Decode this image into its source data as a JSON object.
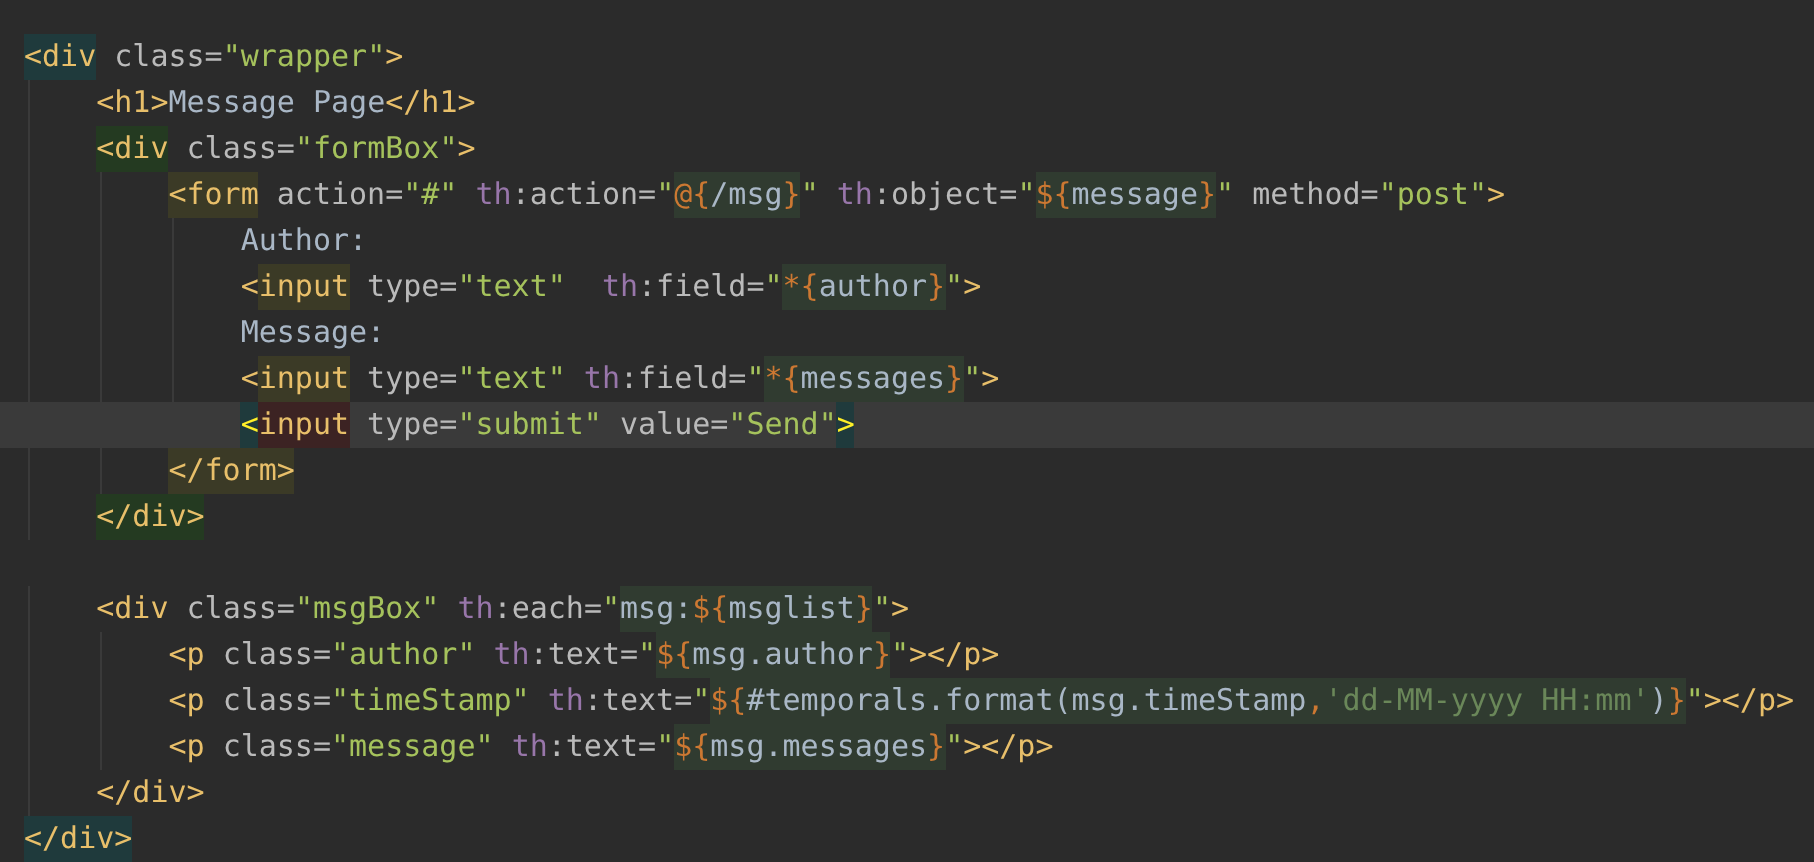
{
  "editor": {
    "lines": [
      {
        "current": false,
        "tokens": [
          {
            "kind": "tag",
            "text": "<div",
            "color": "#1f3a3c"
          },
          {
            "kind": "attr",
            "text": " class="
          },
          {
            "kind": "str",
            "text": "\"wrapper\""
          },
          {
            "kind": "tag",
            "text": ">"
          }
        ]
      },
      {
        "current": false,
        "tokens": [
          {
            "kind": "tag",
            "text": "    <h1>"
          },
          {
            "kind": "text",
            "text": "Message Page"
          },
          {
            "kind": "tag",
            "text": "</h1>"
          }
        ]
      },
      {
        "current": false,
        "tokens": [
          {
            "kind": "tag",
            "text": "    <div",
            "color": "#243a21"
          },
          {
            "kind": "attr",
            "text": " class="
          },
          {
            "kind": "str",
            "text": "\"formBox\""
          },
          {
            "kind": "tag",
            "text": ">"
          }
        ]
      },
      {
        "current": false,
        "tokens": [
          {
            "kind": "tag",
            "text": "        <form",
            "color": "#3b3a26"
          },
          {
            "kind": "attr",
            "text": " action="
          },
          {
            "kind": "str",
            "text": "\"#\""
          },
          {
            "kind": "ns",
            "text": " th"
          },
          {
            "kind": "attr",
            "text": ":action="
          },
          {
            "kind": "str",
            "text": "\""
          },
          {
            "kind": "brace",
            "text": "@{",
            "color": "#303b30"
          },
          {
            "kind": "ident",
            "text": "/msg",
            "color": "#303b30"
          },
          {
            "kind": "brace",
            "text": "}",
            "color": "#303b30"
          },
          {
            "kind": "str",
            "text": "\""
          },
          {
            "kind": "ns",
            "text": " th"
          },
          {
            "kind": "attr",
            "text": ":object="
          },
          {
            "kind": "str",
            "text": "\""
          },
          {
            "kind": "brace",
            "text": "${",
            "color": "#303b30"
          },
          {
            "kind": "ident",
            "text": "message",
            "color": "#303b30"
          },
          {
            "kind": "brace",
            "text": "}",
            "color": "#303b30"
          },
          {
            "kind": "str",
            "text": "\""
          },
          {
            "kind": "attr",
            "text": " method="
          },
          {
            "kind": "str",
            "text": "\"post\""
          },
          {
            "kind": "tag",
            "text": ">"
          }
        ]
      },
      {
        "current": false,
        "tokens": [
          {
            "kind": "text",
            "text": "            Author:"
          }
        ]
      },
      {
        "current": false,
        "tokens": [
          {
            "kind": "tag",
            "text": "            <"
          },
          {
            "kind": "tag",
            "text": "input",
            "color": "#3b3a26"
          },
          {
            "kind": "attr",
            "text": " type="
          },
          {
            "kind": "str",
            "text": "\"text\""
          },
          {
            "kind": "ns",
            "text": "  th"
          },
          {
            "kind": "attr",
            "text": ":field="
          },
          {
            "kind": "str",
            "text": "\""
          },
          {
            "kind": "brace",
            "text": "*{",
            "color": "#303b30"
          },
          {
            "kind": "ident",
            "text": "author",
            "color": "#303b30"
          },
          {
            "kind": "brace",
            "text": "}",
            "color": "#303b30"
          },
          {
            "kind": "str",
            "text": "\""
          },
          {
            "kind": "tag",
            "text": ">"
          }
        ]
      },
      {
        "current": false,
        "tokens": [
          {
            "kind": "text",
            "text": "            Message:"
          }
        ]
      },
      {
        "current": false,
        "tokens": [
          {
            "kind": "tag",
            "text": "            <"
          },
          {
            "kind": "tag",
            "text": "input",
            "color": "#3b3a26"
          },
          {
            "kind": "attr",
            "text": " type="
          },
          {
            "kind": "str",
            "text": "\"text\""
          },
          {
            "kind": "ns",
            "text": " th"
          },
          {
            "kind": "attr",
            "text": ":field="
          },
          {
            "kind": "str",
            "text": "\""
          },
          {
            "kind": "brace",
            "text": "*{",
            "color": "#303b30"
          },
          {
            "kind": "ident",
            "text": "messages",
            "color": "#303b30"
          },
          {
            "kind": "brace",
            "text": "}",
            "color": "#303b30"
          },
          {
            "kind": "str",
            "text": "\""
          },
          {
            "kind": "tag",
            "text": ">"
          }
        ]
      },
      {
        "current": true,
        "tokens": [
          {
            "kind": "match",
            "text": "            <",
            "color": "#1f3a3c"
          },
          {
            "kind": "tag",
            "text": "input",
            "color": "#3c2323"
          },
          {
            "kind": "attr",
            "text": " type="
          },
          {
            "kind": "str",
            "text": "\"submit\""
          },
          {
            "kind": "attr",
            "text": " value="
          },
          {
            "kind": "str",
            "text": "\"Send\""
          },
          {
            "kind": "match",
            "text": ">",
            "color": "#1f3a3c"
          }
        ]
      },
      {
        "current": false,
        "tokens": [
          {
            "kind": "tag",
            "text": "        </form>",
            "color": "#3b3a26"
          }
        ]
      },
      {
        "current": false,
        "tokens": [
          {
            "kind": "tag",
            "text": "    </div>",
            "color": "#243a21"
          }
        ]
      },
      {
        "current": false
      },
      {
        "current": false,
        "tokens": [
          {
            "kind": "tag",
            "text": "    <div"
          },
          {
            "kind": "attr",
            "text": " class="
          },
          {
            "kind": "str",
            "text": "\"msgBox\""
          },
          {
            "kind": "ns",
            "text": " th"
          },
          {
            "kind": "attr",
            "text": ":each="
          },
          {
            "kind": "str",
            "text": "\""
          },
          {
            "kind": "ident",
            "text": "msg:",
            "color": "#303b30"
          },
          {
            "kind": "brace",
            "text": "${",
            "color": "#303b30"
          },
          {
            "kind": "ident",
            "text": "msglist",
            "color": "#303b30"
          },
          {
            "kind": "brace",
            "text": "}",
            "color": "#303b30"
          },
          {
            "kind": "str",
            "text": "\""
          },
          {
            "kind": "tag",
            "text": ">"
          }
        ]
      },
      {
        "current": false,
        "tokens": [
          {
            "kind": "tag",
            "text": "        <p"
          },
          {
            "kind": "attr",
            "text": " class="
          },
          {
            "kind": "str",
            "text": "\"author\""
          },
          {
            "kind": "ns",
            "text": " th"
          },
          {
            "kind": "attr",
            "text": ":text="
          },
          {
            "kind": "str",
            "text": "\""
          },
          {
            "kind": "brace",
            "text": "${",
            "color": "#303b30"
          },
          {
            "kind": "ident",
            "text": "msg.author",
            "color": "#303b30"
          },
          {
            "kind": "brace",
            "text": "}",
            "color": "#303b30"
          },
          {
            "kind": "str",
            "text": "\""
          },
          {
            "kind": "tag",
            "text": "></p>"
          }
        ]
      },
      {
        "current": false,
        "tokens": [
          {
            "kind": "tag",
            "text": "        <p"
          },
          {
            "kind": "attr",
            "text": " class="
          },
          {
            "kind": "str",
            "text": "\"timeStamp\""
          },
          {
            "kind": "ns",
            "text": " th"
          },
          {
            "kind": "attr",
            "text": ":text="
          },
          {
            "kind": "str",
            "text": "\""
          },
          {
            "kind": "brace",
            "text": "${",
            "color": "#303b30"
          },
          {
            "kind": "ident",
            "text": "#temporals.format(msg.timeStamp",
            "color": "#303b30"
          },
          {
            "kind": "brace",
            "text": ",",
            "color": "#303b30"
          },
          {
            "kind": "literal",
            "text": "'dd-MM-yyyy HH:mm'",
            "color": "#303b30"
          },
          {
            "kind": "ident",
            "text": ")",
            "color": "#303b30"
          },
          {
            "kind": "brace",
            "text": "}",
            "color": "#303b30"
          },
          {
            "kind": "str",
            "text": "\""
          },
          {
            "kind": "tag",
            "text": "></p>"
          }
        ]
      },
      {
        "current": false,
        "tokens": [
          {
            "kind": "tag",
            "text": "        <p"
          },
          {
            "kind": "attr",
            "text": " class="
          },
          {
            "kind": "str",
            "text": "\"message\""
          },
          {
            "kind": "ns",
            "text": " th"
          },
          {
            "kind": "attr",
            "text": ":text="
          },
          {
            "kind": "str",
            "text": "\""
          },
          {
            "kind": "brace",
            "text": "${",
            "color": "#303b30"
          },
          {
            "kind": "ident",
            "text": "msg.messages",
            "color": "#303b30"
          },
          {
            "kind": "brace",
            "text": "}",
            "color": "#303b30"
          },
          {
            "kind": "str",
            "text": "\""
          },
          {
            "kind": "tag",
            "text": "></p>"
          }
        ]
      },
      {
        "current": false,
        "tokens": [
          {
            "kind": "tag",
            "text": "    </div>"
          }
        ]
      },
      {
        "current": false,
        "tokens": [
          {
            "kind": "tag",
            "text": "</div>",
            "color": "#1f3a3c"
          }
        ]
      }
    ]
  }
}
